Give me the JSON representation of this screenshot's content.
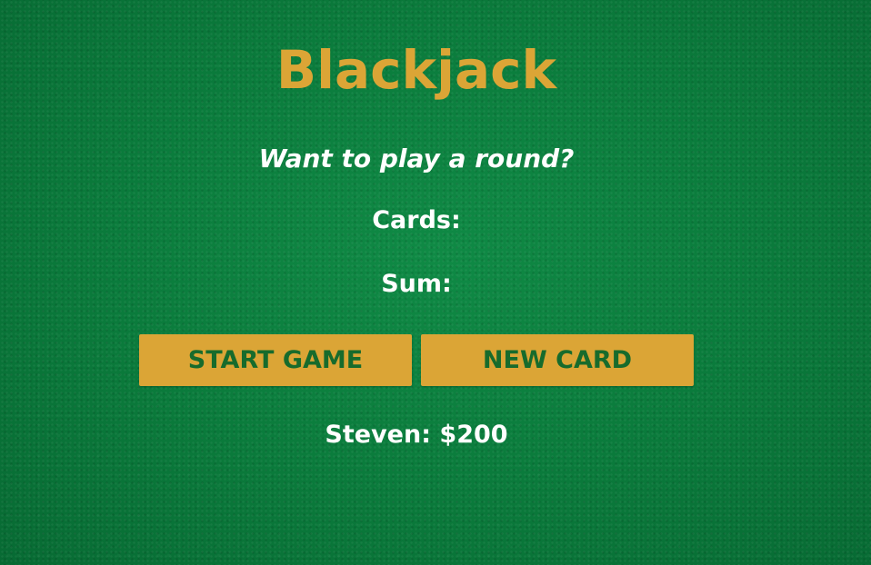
{
  "game": {
    "title": "Blackjack",
    "message": "Want to play a round?",
    "cards_label": "Cards:",
    "sum_label": "Sum:",
    "player_text": "Steven: $200"
  },
  "buttons": {
    "start_label": "START GAME",
    "new_card_label": "NEW CARD"
  },
  "colors": {
    "felt": "#0b7a3c",
    "accent": "#dba536",
    "button_text": "#176b2c",
    "text": "#ffffff"
  }
}
